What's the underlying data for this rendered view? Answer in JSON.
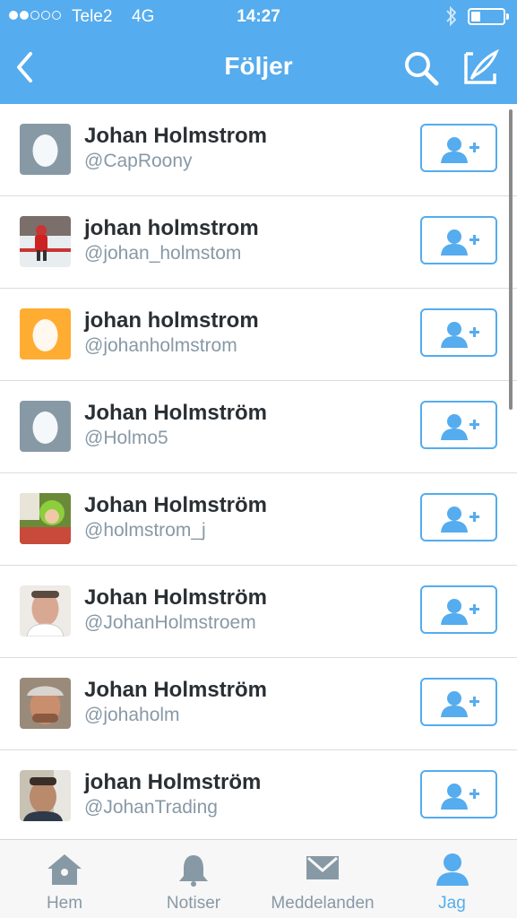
{
  "status_bar": {
    "carrier": "Tele2",
    "network": "4G",
    "time": "14:27",
    "signal_strength": 2,
    "signal_max": 5,
    "battery_level": 0.25
  },
  "nav": {
    "title": "Följer",
    "back_icon": "chevron-left-icon",
    "search_icon": "search-icon",
    "compose_icon": "compose-tweet-icon"
  },
  "users": [
    {
      "name": "Johan Holmstrom",
      "handle": "@CapRoony",
      "avatar": "egg-gray"
    },
    {
      "name": "johan holmstrom",
      "handle": "@johan_holmstom",
      "avatar": "hockey-photo"
    },
    {
      "name": "johan holmstrom",
      "handle": "@johanholmstrom",
      "avatar": "egg-orange"
    },
    {
      "name": "Johan Holmström",
      "handle": "@Holmo5",
      "avatar": "egg-gray"
    },
    {
      "name": "Johan Holmström",
      "handle": "@holmstrom_j",
      "avatar": "child-photo"
    },
    {
      "name": "Johan Holmström",
      "handle": "@JohanHolmstroem",
      "avatar": "face-photo"
    },
    {
      "name": "Johan Holmström",
      "handle": "@johaholm",
      "avatar": "cap-photo"
    },
    {
      "name": "johan Holmström",
      "handle": "@JohanTrading",
      "avatar": "selfie-photo"
    }
  ],
  "follow_icon": "follow-user-icon",
  "tabs": [
    {
      "label": "Hem",
      "icon": "home-icon",
      "active": false
    },
    {
      "label": "Notiser",
      "icon": "bell-icon",
      "active": false
    },
    {
      "label": "Meddelanden",
      "icon": "envelope-icon",
      "active": false
    },
    {
      "label": "Jag",
      "icon": "person-icon",
      "active": true
    }
  ],
  "colors": {
    "accent": "#55acee",
    "egg_gray": "#8899a6",
    "egg_orange": "#ffac33",
    "text": "#292f33",
    "muted": "#8899a6"
  }
}
